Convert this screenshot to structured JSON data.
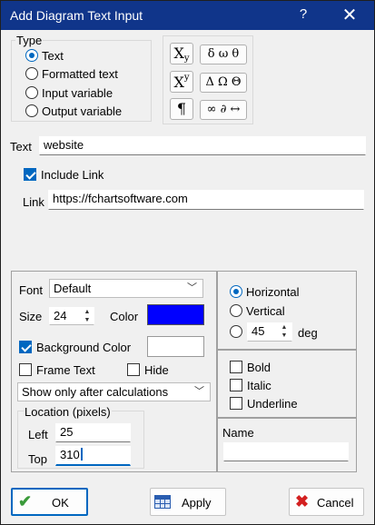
{
  "window": {
    "title": "Add Diagram Text Input",
    "help": "?",
    "close": "✕"
  },
  "type_group": {
    "label": "Type",
    "options": [
      "Text",
      "Formatted text",
      "Input variable",
      "Output variable"
    ],
    "selected": "Text"
  },
  "symbols": {
    "subscript_base": "X",
    "subscript": "y",
    "superscript_base": "X",
    "superscript": "y",
    "paragraph": "¶",
    "greek_lower": "δ ω θ",
    "greek_upper": "Δ Ω Θ",
    "math_symbols": "∞ ∂ ↔"
  },
  "text_field": {
    "label": "Text",
    "value": "website"
  },
  "include_link": {
    "label": "Include Link",
    "checked": true
  },
  "link_field": {
    "label": "Link",
    "value": "https://fchartsoftware.com"
  },
  "font": {
    "label": "Font",
    "value": "Default"
  },
  "size": {
    "label": "Size",
    "value": "24"
  },
  "color": {
    "label": "Color",
    "value": "#0000ff"
  },
  "background_color": {
    "label": "Background Color",
    "checked": true,
    "value": "#ffffff"
  },
  "frame_text": {
    "label": "Frame Text",
    "checked": false
  },
  "hide": {
    "label": "Hide",
    "checked": false
  },
  "show_when": {
    "value": "Show only after calculations"
  },
  "location": {
    "label": "Location (pixels)",
    "left_label": "Left",
    "left": "25",
    "top_label": "Top",
    "top": "310"
  },
  "orientation": {
    "options": [
      "Horizontal",
      "Vertical"
    ],
    "selected": "Horizontal",
    "angle": "45",
    "angle_unit": "deg"
  },
  "style": {
    "bold": "Bold",
    "italic": "Italic",
    "underline": "Underline"
  },
  "name_field": {
    "label": "Name",
    "value": ""
  },
  "buttons": {
    "ok": "OK",
    "apply": "Apply",
    "cancel": "Cancel"
  },
  "colors": {
    "titlebar": "#10358a",
    "accent": "#0067c0"
  }
}
